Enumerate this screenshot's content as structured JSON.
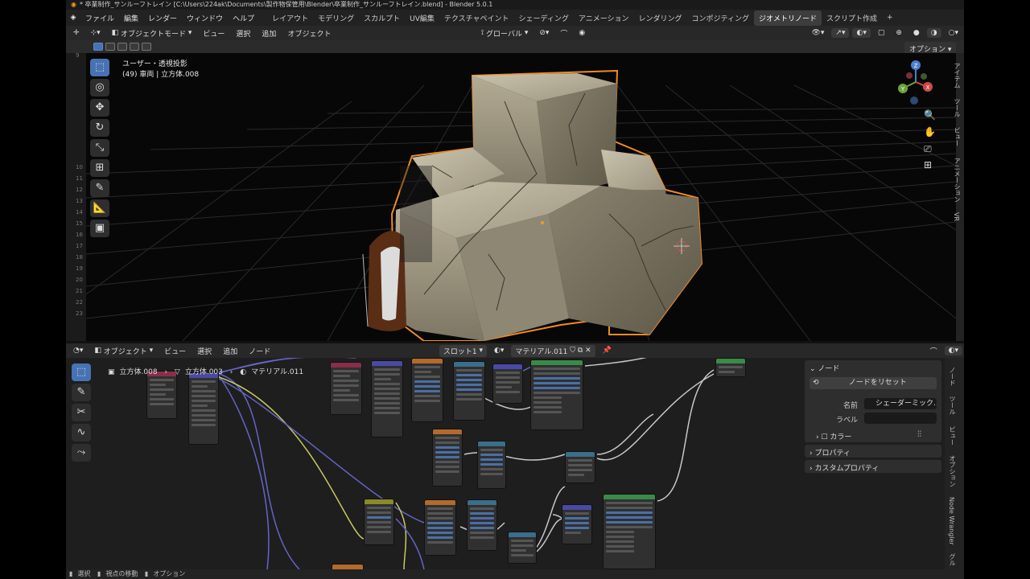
{
  "window": {
    "title": "* 卒業制作_サンルーフトレイン [C:\\Users\\224ak\\Documents\\製作物保管用\\Blender\\卒業制作_サンルーフトレイン.blend] - Blender 5.0.1"
  },
  "menu": {
    "items": [
      "ファイル",
      "編集",
      "レンダー",
      "ウィンドウ",
      "ヘルプ"
    ],
    "workspaces": [
      "レイアウト",
      "モデリング",
      "スカルプト",
      "UV編集",
      "テクスチャペイント",
      "シェーディング",
      "アニメーション",
      "レンダリング",
      "コンポジティング",
      "ジオメトリノード",
      "スクリプト作成"
    ],
    "active_workspace": "ジオメトリノード",
    "add_tab": "+"
  },
  "viewport_header": {
    "mode": "オブジェクトモード",
    "menus": [
      "ビュー",
      "選択",
      "追加",
      "オブジェクト"
    ],
    "transform_orientation": "グローバル",
    "options": "オプション"
  },
  "viewport": {
    "view_name": "ユーザー・透視投影",
    "object_info": "(49) 車両 | 立方体.008",
    "ruler_numbers": [
      "9",
      "10",
      "11",
      "12",
      "13",
      "14",
      "15",
      "16",
      "17",
      "18",
      "19",
      "20",
      "21",
      "22",
      "23"
    ],
    "sidebar_tabs": [
      "アイテム",
      "ツール",
      "ビュー",
      "アニメーション",
      "VR"
    ],
    "gizmo_axes": {
      "z": "Z",
      "x": "X",
      "y": "Y"
    }
  },
  "node_header": {
    "mode": "オブジェクト",
    "menus": [
      "ビュー",
      "選択",
      "追加",
      "ノード"
    ],
    "slot": "スロット1",
    "material": "マテリアル.011"
  },
  "breadcrumb": [
    "立方体.008",
    "立方体.003",
    "マテリアル.011"
  ],
  "node_panel": {
    "node_section": "ノード",
    "reset_button": "ノードをリセット",
    "name_label": "名前",
    "name_value": "シェーダーミック...",
    "label_label": "ラベル",
    "label_value": "",
    "color_label": "カラー",
    "properties_section": "プロパティ",
    "custom_properties_section": "カスタムプロパティ",
    "tabs": [
      "ノード",
      "ツール",
      "ビュー",
      "オプション",
      "Node Wrangler",
      "グル"
    ]
  },
  "statusbar": {
    "items": [
      "選択",
      "視点の移動",
      "オプション"
    ]
  }
}
